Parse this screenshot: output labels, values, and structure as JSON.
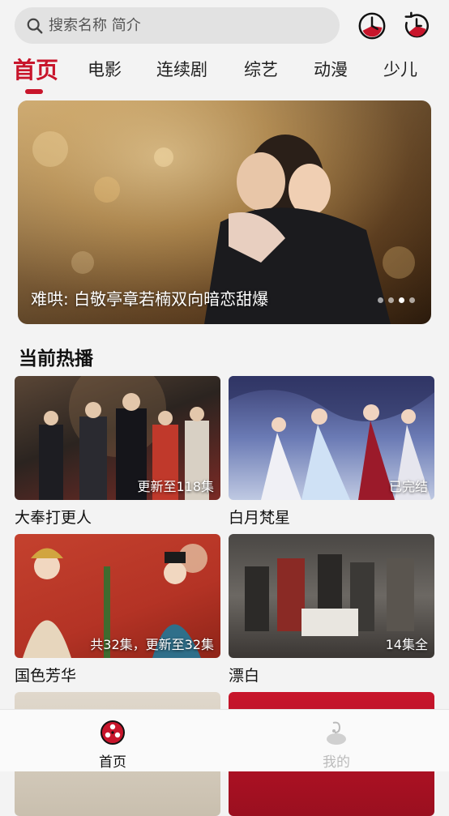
{
  "search": {
    "placeholder": "搜索名称 简介"
  },
  "header_icons": [
    "history-clock-icon",
    "refresh-clock-icon"
  ],
  "tabs": [
    {
      "label": "首页",
      "active": true
    },
    {
      "label": "电影"
    },
    {
      "label": "连续剧"
    },
    {
      "label": "综艺"
    },
    {
      "label": "动漫"
    },
    {
      "label": "少儿"
    }
  ],
  "banner": {
    "caption": "难哄: 白敬亭章若楠双向暗恋甜爆"
  },
  "section": {
    "title": "当前热播"
  },
  "cards": [
    {
      "title": "大奉打更人",
      "badge": "更新至118集"
    },
    {
      "title": "白月梵星",
      "badge": "已完结"
    },
    {
      "title": "国色芳华",
      "badge": "共32集，更新至32集"
    },
    {
      "title": "漂白",
      "badge": "14集全"
    },
    {
      "title": "",
      "badge": ""
    },
    {
      "title": "",
      "badge": ""
    }
  ],
  "bottom_nav": [
    {
      "label": "首页",
      "icon": "film-reel-icon",
      "active": true
    },
    {
      "label": "我的",
      "icon": "user-icon",
      "active": false
    }
  ],
  "colors": {
    "accent": "#c8152b",
    "background": "#f3f3f3"
  }
}
